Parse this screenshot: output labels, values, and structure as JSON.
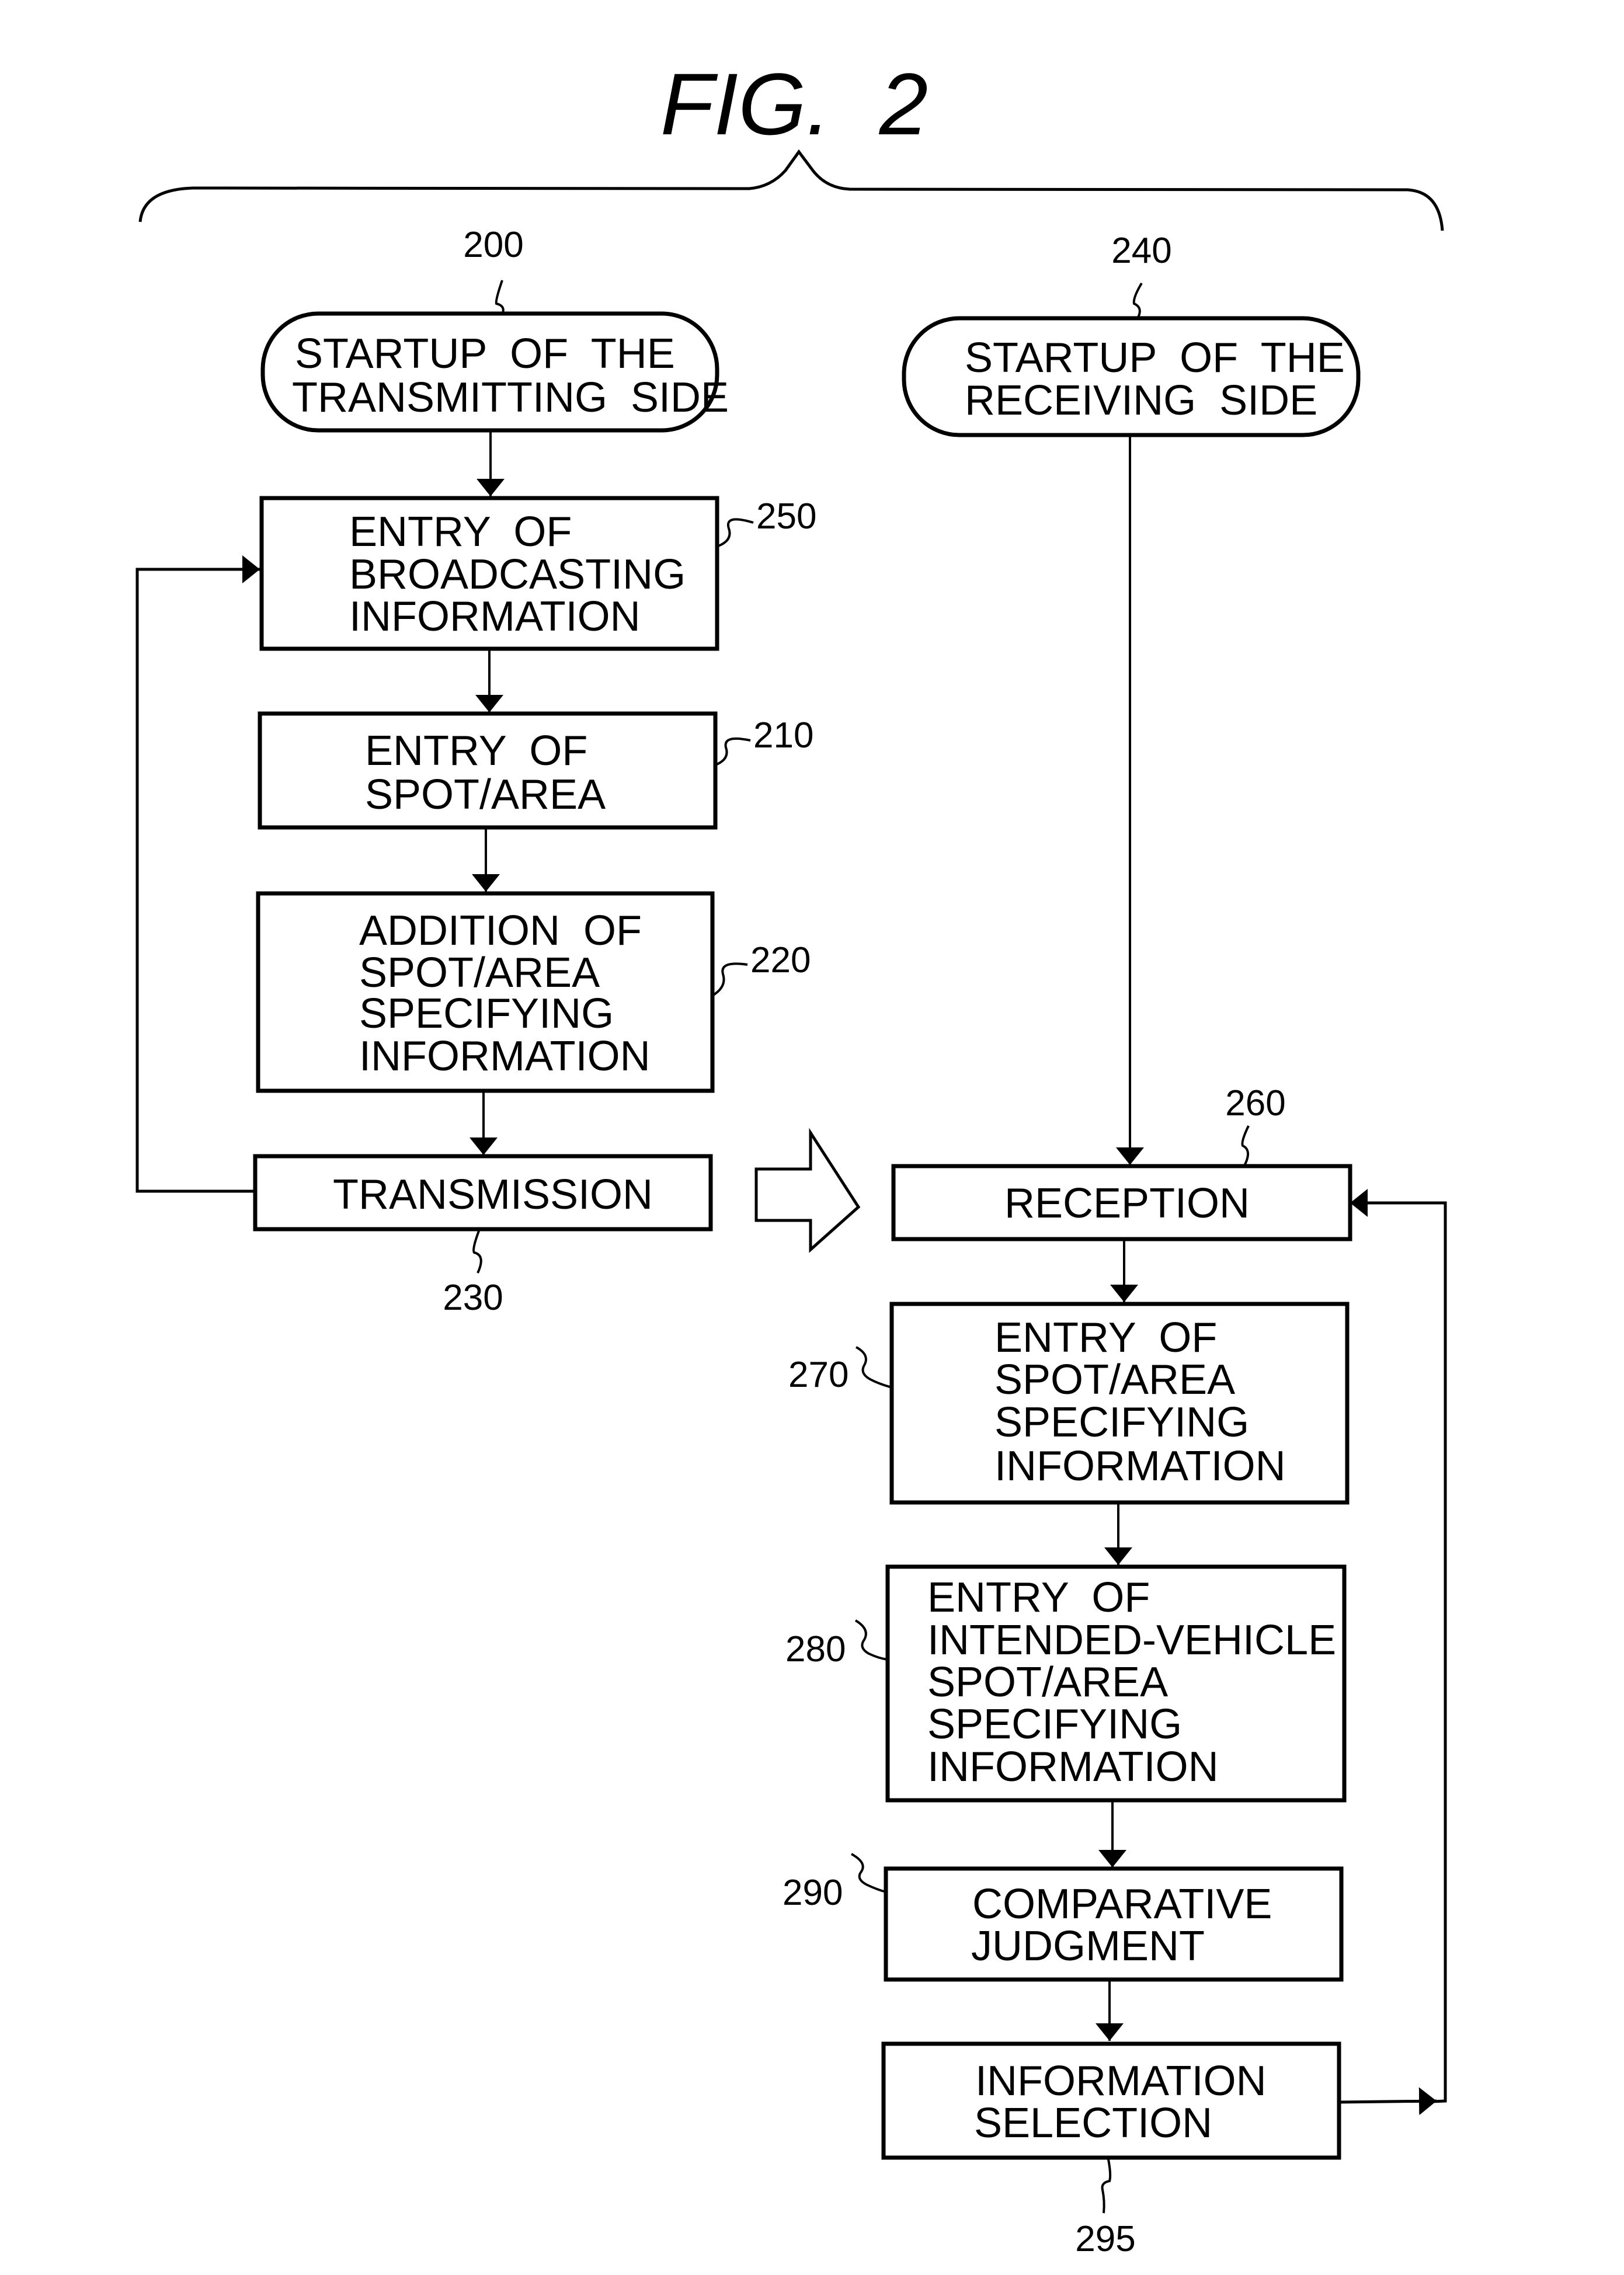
{
  "figure": {
    "title": "FIG.  2"
  },
  "transmitting_side": {
    "start": {
      "ref": "200",
      "lines": [
        "STARTUP  OF  THE",
        "TRANSMITTING  SIDE"
      ]
    },
    "steps": [
      {
        "id": "entry-broadcasting-info",
        "ref": "250",
        "lines": [
          "ENTRY  OF",
          "BROADCASTING",
          "INFORMATION"
        ]
      },
      {
        "id": "entry-spot-area",
        "ref": "210",
        "lines": [
          "ENTRY  OF",
          "SPOT/AREA"
        ]
      },
      {
        "id": "addition-spot-area-info",
        "ref": "220",
        "lines": [
          "ADDITION  OF",
          "SPOT/AREA",
          "SPECIFYING",
          "INFORMATION"
        ]
      },
      {
        "id": "transmission",
        "ref": "230",
        "lines": [
          "TRANSMISSION"
        ]
      }
    ]
  },
  "receiving_side": {
    "start": {
      "ref": "240",
      "lines": [
        "STARTUP  OF  THE",
        "RECEIVING  SIDE"
      ]
    },
    "steps": [
      {
        "id": "reception",
        "ref": "260",
        "lines": [
          "RECEPTION"
        ]
      },
      {
        "id": "entry-spot-area-info",
        "ref": "270",
        "lines": [
          "ENTRY  OF",
          "SPOT/AREA",
          "SPECIFYING",
          "INFORMATION"
        ]
      },
      {
        "id": "entry-intended-vehicle",
        "ref": "280",
        "lines": [
          "ENTRY  OF",
          "INTENDED-VEHICLE",
          "SPOT/AREA",
          "SPECIFYING",
          "INFORMATION"
        ]
      },
      {
        "id": "comparative-judgment",
        "ref": "290",
        "lines": [
          "COMPARATIVE",
          "JUDGMENT"
        ]
      },
      {
        "id": "information-selection",
        "ref": "295",
        "lines": [
          "INFORMATION",
          "SELECTION"
        ]
      }
    ]
  },
  "connections": [
    {
      "from": "start-transmitting",
      "to": "entry-broadcasting-info",
      "type": "arrow"
    },
    {
      "from": "entry-broadcasting-info",
      "to": "entry-spot-area",
      "type": "arrow"
    },
    {
      "from": "entry-spot-area",
      "to": "addition-spot-area-info",
      "type": "arrow"
    },
    {
      "from": "addition-spot-area-info",
      "to": "transmission",
      "type": "arrow"
    },
    {
      "from": "transmission",
      "to": "entry-broadcasting-info",
      "type": "loop-arrow"
    },
    {
      "from": "transmission",
      "to": "reception",
      "type": "broadcast-hollow-arrow"
    },
    {
      "from": "start-receiving",
      "to": "reception",
      "type": "arrow"
    },
    {
      "from": "reception",
      "to": "entry-spot-area-info",
      "type": "arrow"
    },
    {
      "from": "entry-spot-area-info",
      "to": "entry-intended-vehicle",
      "type": "arrow"
    },
    {
      "from": "entry-intended-vehicle",
      "to": "comparative-judgment",
      "type": "arrow"
    },
    {
      "from": "comparative-judgment",
      "to": "information-selection",
      "type": "arrow"
    },
    {
      "from": "information-selection",
      "to": "reception",
      "type": "loop-arrow"
    }
  ]
}
